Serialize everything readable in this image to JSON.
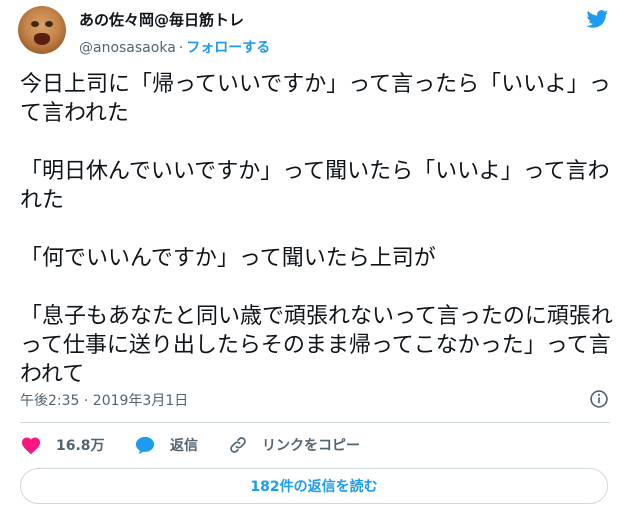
{
  "user": {
    "display_name": "あの佐々岡@毎日筋トレ",
    "handle": "@anosasaoka",
    "separator": "·",
    "follow_label": "フォローする",
    "avatar_icon": "cat-avatar"
  },
  "tweet": {
    "paragraphs": [
      "今日上司に「帰っていいですか」って言ったら「いいよ」って言われた",
      "「明日休んでいいですか」って聞いたら「いいよ」って言われた",
      "「何でいいんですか」って聞いたら上司が",
      "「息子もあなたと同い歳で頑張れないって言ったのに頑張れって仕事に送り出したらそのまま帰ってこなかった」って言われて"
    ],
    "timestamp": "午後2:35 · 2019年3月1日"
  },
  "actions": {
    "likes": "16.8万",
    "reply_label": "返信",
    "copy_link_label": "リンクをコピー"
  },
  "footer": {
    "read_replies_label": "182件の返信を読む"
  },
  "colors": {
    "accent": "#1d9bf0",
    "like": "#f91880",
    "text": "#0f1419",
    "secondary": "#536471",
    "border": "#cfd9de"
  }
}
